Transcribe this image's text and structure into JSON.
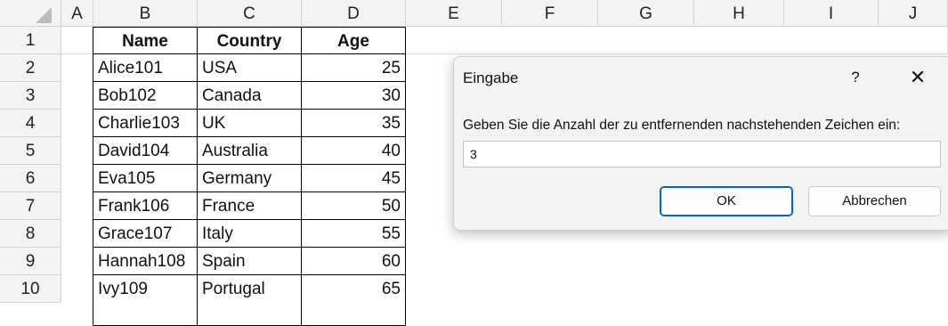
{
  "columns": [
    "A",
    "B",
    "C",
    "D",
    "E",
    "F",
    "G",
    "H",
    "I",
    "J"
  ],
  "rows": [
    "1",
    "2",
    "3",
    "4",
    "5",
    "6",
    "7",
    "8",
    "9",
    "10"
  ],
  "table": {
    "headers": [
      "Name",
      "Country",
      "Age"
    ],
    "data": [
      [
        "Alice101",
        "USA",
        "25"
      ],
      [
        "Bob102",
        "Canada",
        "30"
      ],
      [
        "Charlie103",
        "UK",
        "35"
      ],
      [
        "David104",
        "Australia",
        "40"
      ],
      [
        "Eva105",
        "Germany",
        "45"
      ],
      [
        "Frank106",
        "France",
        "50"
      ],
      [
        "Grace107",
        "Italy",
        "55"
      ],
      [
        "Hannah108",
        "Spain",
        "60"
      ],
      [
        "Ivy109",
        "Portugal",
        "65"
      ]
    ]
  },
  "dialog": {
    "title": "Eingabe",
    "help_label": "?",
    "close_label": "✕",
    "prompt": "Geben Sie die Anzahl der zu entfernenden nachstehenden Zeichen ein:",
    "input_value": "3",
    "ok_label": "OK",
    "cancel_label": "Abbrechen"
  },
  "colors": {
    "header_bg": "#f3f3f3",
    "grid_line": "#e1e1e1",
    "accent": "#0067c0"
  }
}
